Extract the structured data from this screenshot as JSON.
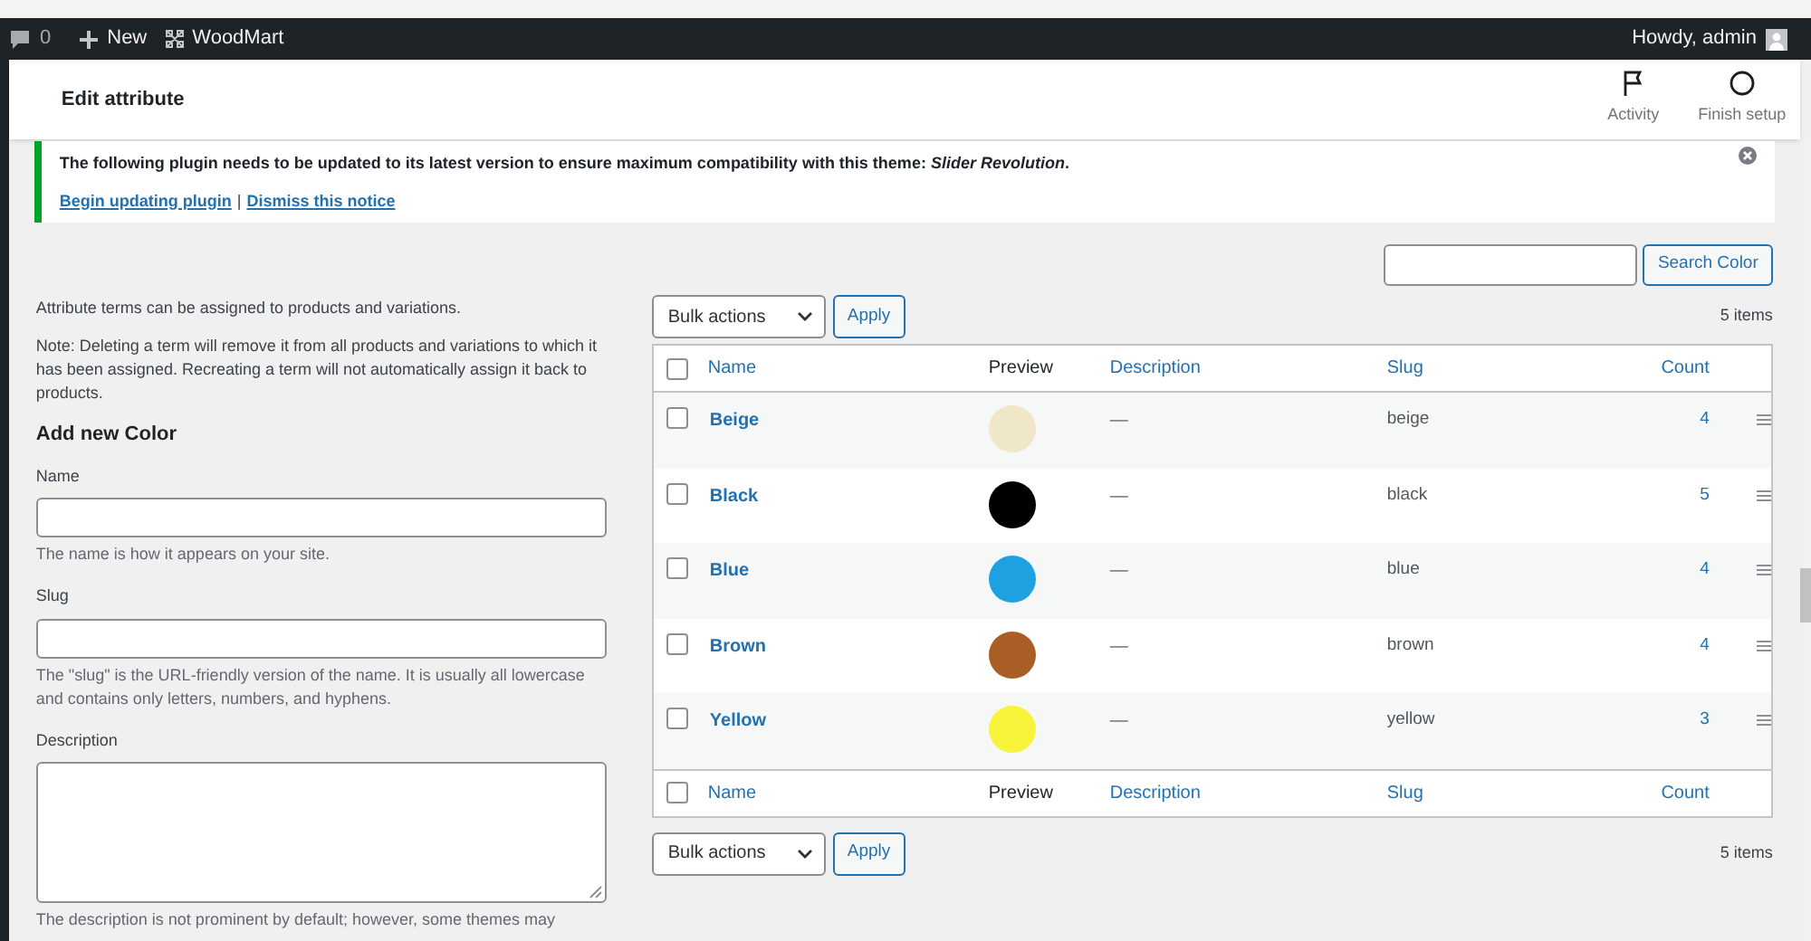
{
  "admin_bar": {
    "comments_count": "0",
    "new_label": "New",
    "site_name": "WoodMart",
    "greeting": "Howdy, admin"
  },
  "header": {
    "title": "Edit attribute",
    "actions": [
      {
        "label": "Activity",
        "kind": "flag"
      },
      {
        "label": "Finish setup",
        "kind": "circle"
      }
    ]
  },
  "notice": {
    "message": "The following plugin needs to be updated to its latest version to ensure maximum compatibility with this theme: *Slider Revolution*.",
    "links": [
      "Begin updating plugin",
      "Dismiss this notice"
    ],
    "separator": "|"
  },
  "form": {
    "intro": "Attribute terms can be assigned to products and variations.",
    "note": "Note: Deleting a term will remove it from all products and variations to which it has been assigned. Recreating a term will not automatically assign it back to products.",
    "heading": "Add new Color",
    "fields": [
      {
        "label": "Name",
        "kind": "input",
        "help": "The name is how it appears on your site."
      },
      {
        "label": "Slug",
        "kind": "input",
        "help": "The \"slug\" is the URL-friendly version of the name. It is usually all lowercase and contains only letters, numbers, and hyphens."
      },
      {
        "label": "Description",
        "kind": "textarea",
        "help": "The description is not prominent by default; however, some themes may"
      }
    ]
  },
  "search": {
    "button": "Search Color"
  },
  "top_nav": {
    "bulk": "Bulk actions",
    "apply": "Apply",
    "count": "5 items"
  },
  "table": {
    "header": {
      "checked": false,
      "columns": [
        {
          "label": "Name",
          "sortable": true
        },
        {
          "label": "Preview",
          "sortable": false
        },
        {
          "label": "Description",
          "sortable": true
        },
        {
          "label": "Slug",
          "sortable": true
        },
        {
          "label": "Count",
          "sortable": true
        }
      ]
    },
    "footer": {
      "checked": false,
      "columns": [
        {
          "label": "Name",
          "sortable": true
        },
        {
          "label": "Preview",
          "sortable": false
        },
        {
          "label": "Description",
          "sortable": true
        },
        {
          "label": "Slug",
          "sortable": true
        },
        {
          "label": "Count",
          "sortable": true
        }
      ]
    },
    "rows": [
      {
        "checked": false,
        "name": "Beige",
        "color": "#f0e6c8",
        "description": "—",
        "slug": "beige",
        "count": "4"
      },
      {
        "checked": false,
        "name": "Black",
        "color": "#000000",
        "description": "—",
        "slug": "black",
        "count": "5"
      },
      {
        "checked": false,
        "name": "Blue",
        "color": "#1ea1e1",
        "description": "—",
        "slug": "blue",
        "count": "4"
      },
      {
        "checked": false,
        "name": "Brown",
        "color": "#a95e25",
        "description": "—",
        "slug": "brown",
        "count": "4"
      },
      {
        "checked": false,
        "name": "Yellow",
        "color": "#f8f43c",
        "description": "—",
        "slug": "yellow",
        "count": "3"
      }
    ]
  },
  "bottom_nav": {
    "bulk": "Bulk actions",
    "apply": "Apply",
    "count": "5 items"
  }
}
